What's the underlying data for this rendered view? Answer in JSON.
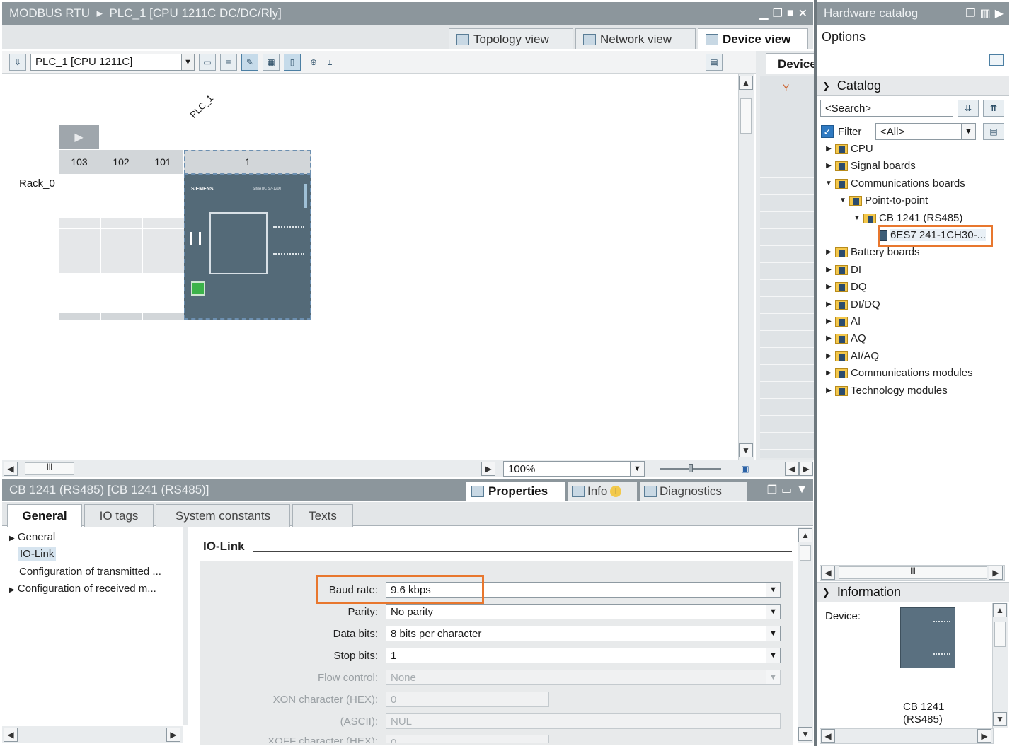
{
  "main_window": {
    "breadcrumb_project": "MODBUS RTU",
    "breadcrumb_sep": "▸",
    "breadcrumb_device": "PLC_1 [CPU 1211C DC/DC/Rly]"
  },
  "view_tabs": {
    "topology": "Topology view",
    "network": "Network view",
    "device": "Device view"
  },
  "toolbar": {
    "device_select": "PLC_1 [CPU 1211C]"
  },
  "device_overview_tab": "Device",
  "canvas": {
    "plc_label": "PLC_1",
    "rack_label": "Rack_0",
    "slots": [
      "103",
      "102",
      "101",
      "1"
    ],
    "zoom": "100%",
    "cpu_brand": "SIEMENS",
    "cpu_series": "SIMATIC S7-1200"
  },
  "inspector": {
    "title": "CB 1241 (RS485) [CB 1241 (RS485)]",
    "tabs": {
      "properties": "Properties",
      "info": "Info",
      "diagnostics": "Diagnostics"
    },
    "subtabs": [
      "General",
      "IO tags",
      "System constants",
      "Texts"
    ],
    "nav": [
      "General",
      "IO-Link",
      "Configuration of transmitted ...",
      "Configuration of received m..."
    ],
    "section_title": "IO-Link",
    "fields": [
      {
        "label": "Baud rate:",
        "value": "9.6 kbps"
      },
      {
        "label": "Parity:",
        "value": "No parity"
      },
      {
        "label": "Data bits:",
        "value": "8 bits per character"
      },
      {
        "label": "Stop bits:",
        "value": "1"
      },
      {
        "label": "Flow control:",
        "value": "None"
      },
      {
        "label": "XON character (HEX):",
        "value": "0"
      },
      {
        "label": "(ASCII):",
        "value": "NUL"
      },
      {
        "label": "XOFF character (HEX):",
        "value": "0"
      }
    ]
  },
  "catalog": {
    "title": "Hardware catalog",
    "options": "Options",
    "section": "Catalog",
    "search_placeholder": "<Search>",
    "filter_label": "Filter",
    "filter_value": "<All>",
    "tree": [
      {
        "label": "CPU",
        "level": 0,
        "state": "closed"
      },
      {
        "label": "Signal boards",
        "level": 0,
        "state": "closed"
      },
      {
        "label": "Communications boards",
        "level": 0,
        "state": "open"
      },
      {
        "label": "Point-to-point",
        "level": 1,
        "state": "open"
      },
      {
        "label": "CB 1241 (RS485)",
        "level": 2,
        "state": "open"
      },
      {
        "label": "6ES7 241-1CH30-...",
        "level": 3,
        "state": "leaf"
      },
      {
        "label": "Battery boards",
        "level": 0,
        "state": "closed"
      },
      {
        "label": "DI",
        "level": 0,
        "state": "closed"
      },
      {
        "label": "DQ",
        "level": 0,
        "state": "closed"
      },
      {
        "label": "DI/DQ",
        "level": 0,
        "state": "closed"
      },
      {
        "label": "AI",
        "level": 0,
        "state": "closed"
      },
      {
        "label": "AQ",
        "level": 0,
        "state": "closed"
      },
      {
        "label": "AI/AQ",
        "level": 0,
        "state": "closed"
      },
      {
        "label": "Communications modules",
        "level": 0,
        "state": "closed"
      },
      {
        "label": "Technology modules",
        "level": 0,
        "state": "closed"
      }
    ],
    "information": "Information",
    "device_label": "Device:",
    "device_name_1": "CB 1241",
    "device_name_2": "(RS485)"
  },
  "colors": {
    "title_bar": "#8c969c",
    "highlight": "#e8772e",
    "cpu_body": "#546a78"
  }
}
